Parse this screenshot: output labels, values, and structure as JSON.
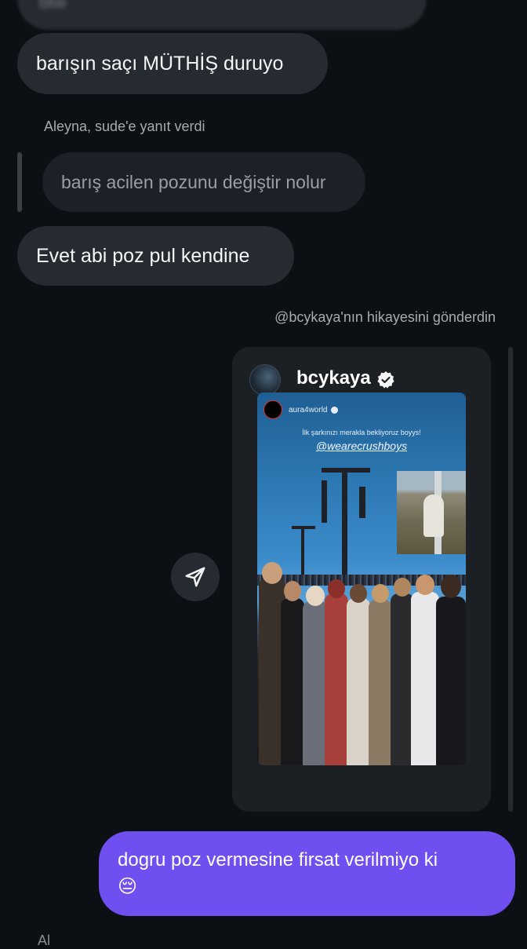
{
  "messages": {
    "top_blurred": "btw",
    "msg1": "barışın saçı MÜTHİŞ duruyo",
    "reply_meta": "Aleyna, sude'e yanıt verdi",
    "reply_quote": "barış acilen pozunu değiştir nolur",
    "msg2": "Evet abi poz pul kendine",
    "shared_meta": "@bcykaya'nın hikayesini gönderdin",
    "my_message": "dogru poz vermesine firsat verilmiyo ki",
    "my_emoji": "😔",
    "bottom_peek": "Al"
  },
  "story": {
    "username": "bcykaya",
    "inner_user": "aura4world",
    "caption": "İlk şarkınızı merakla bekliyoruz boyys!",
    "tag": "@wearecrushboys"
  },
  "colors": {
    "background": "#0c1014",
    "bubble": "#262a31",
    "my_bubble": "#6f4ff0"
  },
  "icons": {
    "share": "send-icon",
    "verified": "verified-badge-icon"
  }
}
